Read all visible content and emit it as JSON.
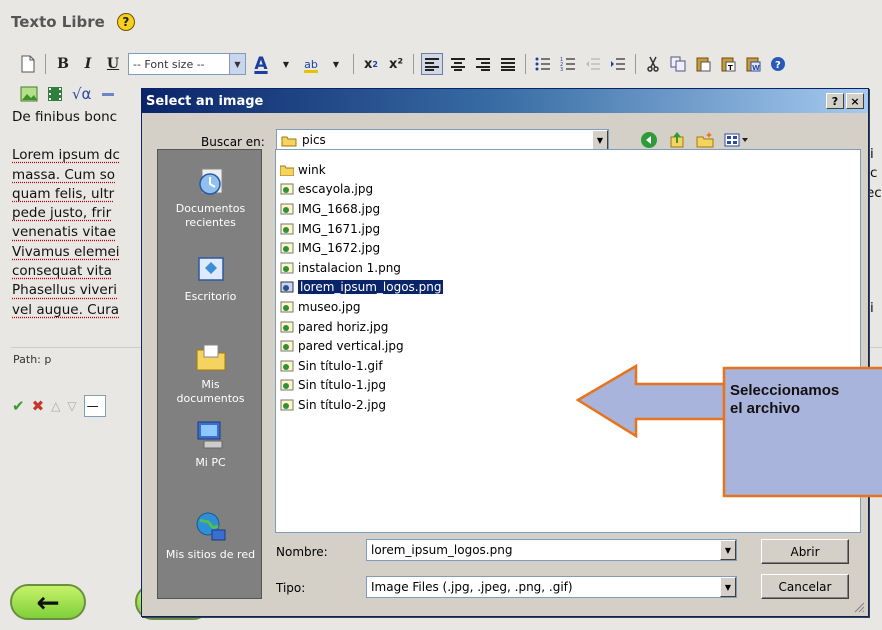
{
  "page": {
    "heading": "Texto Libre",
    "help_badge": "?"
  },
  "toolbar": {
    "font_size_label": "-- Font size --",
    "bold": "B",
    "italic": "I",
    "underline": "U",
    "font_color": "A",
    "highlight": "ab",
    "subscript": "x",
    "superscript": "x²"
  },
  "editor": {
    "lines": [
      "De finibus bonc",
      "",
      "Lorem ipsum dc",
      "massa. Cum so",
      "quam felis, ultr",
      "pede justo, frir",
      "venenatis vitae",
      "Vivamus elemei",
      "consequat vita",
      "Phasellus viveri",
      "vel augue. Cura"
    ],
    "right_fragments": [
      "i",
      "c",
      "ec",
      "i"
    ],
    "path_label": "Path:",
    "path_value": "p"
  },
  "form_row": {
    "input_value": "—"
  },
  "dialog": {
    "title": "Select an image",
    "help_btn": "?",
    "close_btn": "×",
    "look_in_label": "Buscar en:",
    "look_in_value": "pics",
    "places": [
      {
        "label": "Documentos recientes",
        "icon": "recent-docs-icon"
      },
      {
        "label": "Escritorio",
        "icon": "desktop-icon"
      },
      {
        "label": "Mis documentos",
        "icon": "my-documents-icon"
      },
      {
        "label": "Mi PC",
        "icon": "my-computer-icon"
      },
      {
        "label": "Mis sitios de red",
        "icon": "network-places-icon"
      }
    ],
    "files": [
      {
        "name": "wink",
        "type": "folder"
      },
      {
        "name": "escayola.jpg",
        "type": "image"
      },
      {
        "name": "IMG_1668.jpg",
        "type": "image"
      },
      {
        "name": "IMG_1671.jpg",
        "type": "image"
      },
      {
        "name": "IMG_1672.jpg",
        "type": "image"
      },
      {
        "name": "instalacion 1.png",
        "type": "image"
      },
      {
        "name": "lorem_ipsum_logos.png",
        "type": "image",
        "selected": true
      },
      {
        "name": "museo.jpg",
        "type": "image"
      },
      {
        "name": "pared horiz.jpg",
        "type": "image"
      },
      {
        "name": "pared vertical.jpg",
        "type": "image"
      },
      {
        "name": "Sin título-1.gif",
        "type": "image"
      },
      {
        "name": "Sin título-1.jpg",
        "type": "image"
      },
      {
        "name": "Sin título-2.jpg",
        "type": "image"
      }
    ],
    "filename_label": "Nombre:",
    "filename_value": "lorem_ipsum_logos.png",
    "filetype_label": "Tipo:",
    "filetype_value": "Image Files (.jpg, .jpeg, .png, .gif)",
    "open_button": "Abrir",
    "cancel_button": "Cancelar"
  },
  "callout": {
    "line1": "Seleccionamos",
    "line2": "el archivo"
  },
  "nav": {
    "back": "←",
    "forward": "→"
  },
  "colors": {
    "titlebar": "#0a246a",
    "selection": "#0a246a",
    "callout_fill": "#a9b4dd",
    "callout_border": "#e8731c",
    "nav_button": "#9be04e"
  }
}
